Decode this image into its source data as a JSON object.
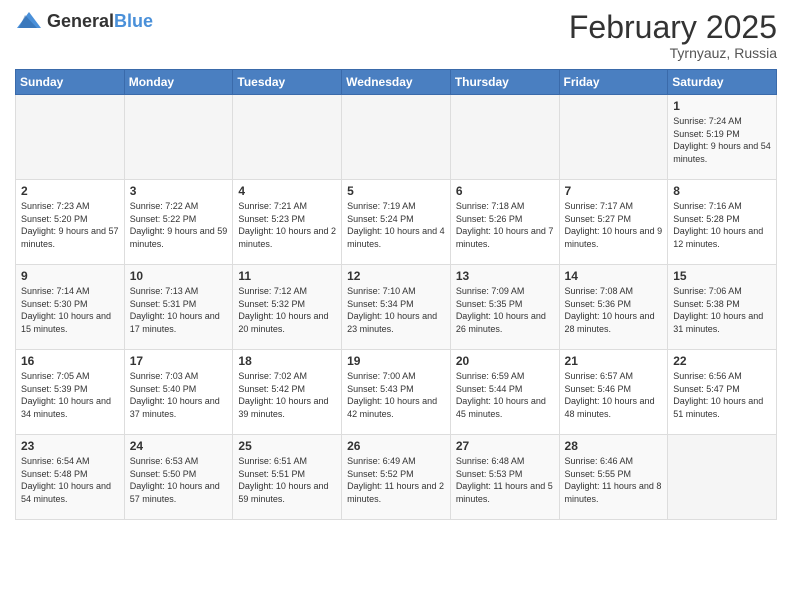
{
  "header": {
    "logo": {
      "general": "General",
      "blue": "Blue"
    },
    "month": "February 2025",
    "location": "Tyrnyauz, Russia"
  },
  "weekdays": [
    "Sunday",
    "Monday",
    "Tuesday",
    "Wednesday",
    "Thursday",
    "Friday",
    "Saturday"
  ],
  "weeks": [
    [
      {
        "day": "",
        "info": ""
      },
      {
        "day": "",
        "info": ""
      },
      {
        "day": "",
        "info": ""
      },
      {
        "day": "",
        "info": ""
      },
      {
        "day": "",
        "info": ""
      },
      {
        "day": "",
        "info": ""
      },
      {
        "day": "1",
        "info": "Sunrise: 7:24 AM\nSunset: 5:19 PM\nDaylight: 9 hours and 54 minutes."
      }
    ],
    [
      {
        "day": "2",
        "info": "Sunrise: 7:23 AM\nSunset: 5:20 PM\nDaylight: 9 hours and 57 minutes."
      },
      {
        "day": "3",
        "info": "Sunrise: 7:22 AM\nSunset: 5:22 PM\nDaylight: 9 hours and 59 minutes."
      },
      {
        "day": "4",
        "info": "Sunrise: 7:21 AM\nSunset: 5:23 PM\nDaylight: 10 hours and 2 minutes."
      },
      {
        "day": "5",
        "info": "Sunrise: 7:19 AM\nSunset: 5:24 PM\nDaylight: 10 hours and 4 minutes."
      },
      {
        "day": "6",
        "info": "Sunrise: 7:18 AM\nSunset: 5:26 PM\nDaylight: 10 hours and 7 minutes."
      },
      {
        "day": "7",
        "info": "Sunrise: 7:17 AM\nSunset: 5:27 PM\nDaylight: 10 hours and 9 minutes."
      },
      {
        "day": "8",
        "info": "Sunrise: 7:16 AM\nSunset: 5:28 PM\nDaylight: 10 hours and 12 minutes."
      }
    ],
    [
      {
        "day": "9",
        "info": "Sunrise: 7:14 AM\nSunset: 5:30 PM\nDaylight: 10 hours and 15 minutes."
      },
      {
        "day": "10",
        "info": "Sunrise: 7:13 AM\nSunset: 5:31 PM\nDaylight: 10 hours and 17 minutes."
      },
      {
        "day": "11",
        "info": "Sunrise: 7:12 AM\nSunset: 5:32 PM\nDaylight: 10 hours and 20 minutes."
      },
      {
        "day": "12",
        "info": "Sunrise: 7:10 AM\nSunset: 5:34 PM\nDaylight: 10 hours and 23 minutes."
      },
      {
        "day": "13",
        "info": "Sunrise: 7:09 AM\nSunset: 5:35 PM\nDaylight: 10 hours and 26 minutes."
      },
      {
        "day": "14",
        "info": "Sunrise: 7:08 AM\nSunset: 5:36 PM\nDaylight: 10 hours and 28 minutes."
      },
      {
        "day": "15",
        "info": "Sunrise: 7:06 AM\nSunset: 5:38 PM\nDaylight: 10 hours and 31 minutes."
      }
    ],
    [
      {
        "day": "16",
        "info": "Sunrise: 7:05 AM\nSunset: 5:39 PM\nDaylight: 10 hours and 34 minutes."
      },
      {
        "day": "17",
        "info": "Sunrise: 7:03 AM\nSunset: 5:40 PM\nDaylight: 10 hours and 37 minutes."
      },
      {
        "day": "18",
        "info": "Sunrise: 7:02 AM\nSunset: 5:42 PM\nDaylight: 10 hours and 39 minutes."
      },
      {
        "day": "19",
        "info": "Sunrise: 7:00 AM\nSunset: 5:43 PM\nDaylight: 10 hours and 42 minutes."
      },
      {
        "day": "20",
        "info": "Sunrise: 6:59 AM\nSunset: 5:44 PM\nDaylight: 10 hours and 45 minutes."
      },
      {
        "day": "21",
        "info": "Sunrise: 6:57 AM\nSunset: 5:46 PM\nDaylight: 10 hours and 48 minutes."
      },
      {
        "day": "22",
        "info": "Sunrise: 6:56 AM\nSunset: 5:47 PM\nDaylight: 10 hours and 51 minutes."
      }
    ],
    [
      {
        "day": "23",
        "info": "Sunrise: 6:54 AM\nSunset: 5:48 PM\nDaylight: 10 hours and 54 minutes."
      },
      {
        "day": "24",
        "info": "Sunrise: 6:53 AM\nSunset: 5:50 PM\nDaylight: 10 hours and 57 minutes."
      },
      {
        "day": "25",
        "info": "Sunrise: 6:51 AM\nSunset: 5:51 PM\nDaylight: 10 hours and 59 minutes."
      },
      {
        "day": "26",
        "info": "Sunrise: 6:49 AM\nSunset: 5:52 PM\nDaylight: 11 hours and 2 minutes."
      },
      {
        "day": "27",
        "info": "Sunrise: 6:48 AM\nSunset: 5:53 PM\nDaylight: 11 hours and 5 minutes."
      },
      {
        "day": "28",
        "info": "Sunrise: 6:46 AM\nSunset: 5:55 PM\nDaylight: 11 hours and 8 minutes."
      },
      {
        "day": "",
        "info": ""
      }
    ]
  ]
}
